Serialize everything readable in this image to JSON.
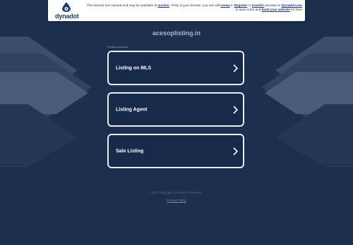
{
  "banner": {
    "logo_text": "dynadot",
    "notice": {
      "p1": "The domain has expired and may be available at ",
      "auction": "auction",
      "p2": ". If this is your domain, you can still ",
      "renew": "renew",
      "p3": " it. ",
      "register": "Register",
      "p4": " or ",
      "transfer": "transfer",
      "p5": " domains to ",
      "dynadot_com": "Dynadot.com",
      "p6": " to save more and ",
      "build": "build your website",
      "p7": " for free!"
    }
  },
  "domain": "acesoplisting.in",
  "related_label": "Related searches",
  "tiles": [
    {
      "label": "Listing on MLS"
    },
    {
      "label": "Listing Agent"
    },
    {
      "label": "Sale Listing"
    }
  ],
  "footer": {
    "copyright": "2023 Copyright. All Rights Reserved.",
    "privacy": "Privacy Policy"
  },
  "colors": {
    "background": "#1c2f4d",
    "tile_background": "#172a4a",
    "tile_border": "#e8edf4",
    "logo_blue": "#1c3c6e",
    "logo_drop": "#2a8fd6"
  }
}
